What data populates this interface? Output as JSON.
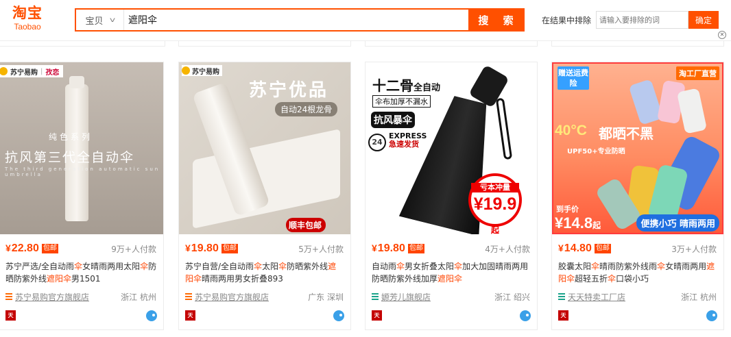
{
  "header": {
    "logo_cn": "淘宝",
    "logo_en": "Taobao",
    "search_category": "宝贝",
    "search_value": "遮阳伞",
    "search_button": "搜 索",
    "exclude_label": "在结果中排除",
    "exclude_placeholder": "请输入要排除的词",
    "exclude_button": "确定"
  },
  "products": [
    {
      "price": "22.80",
      "currency": "¥",
      "tag": "包邮",
      "sold": "9万+人付款",
      "title_parts": [
        "苏宁严选/全自动雨",
        "伞",
        "女晴雨两用太阳",
        "伞",
        "防晒防紫外线",
        "遮阳伞",
        "男1501"
      ],
      "shop": "苏宁易购官方旗舰店",
      "location": "浙江 杭州",
      "shop_icon_color": "orange",
      "image": {
        "brand": "苏宁易购",
        "brand_sub": "孜恋",
        "series": "纯色系列",
        "headline": "抗风第三代全自动伞",
        "small": "The third generation automatic sun umbrella"
      }
    },
    {
      "price": "19.80",
      "currency": "¥",
      "tag": "包邮",
      "sold": "5万+人付款",
      "title_parts": [
        "苏宁自营/全自动雨",
        "伞",
        "太阳",
        "伞",
        "防晒紫外线",
        "遮阳伞",
        "晴雨两用男女折叠893"
      ],
      "shop": "苏宁易购官方旗舰店",
      "location": "广东 深圳",
      "shop_icon_color": "orange",
      "image": {
        "brand": "苏宁易购",
        "headline": "苏宁优品",
        "pill": "自动24根龙骨",
        "ship": "顺丰包邮"
      }
    },
    {
      "price": "19.80",
      "currency": "¥",
      "tag": "包邮",
      "sold": "4万+人付款",
      "title_parts": [
        "自动雨",
        "伞",
        "男女折叠太阳",
        "伞",
        "加大加固晴雨两用防晒防紫外线加厚",
        "遮阳伞",
        ""
      ],
      "shop": "嫄芳儿旗舰店",
      "location": "浙江 绍兴",
      "shop_icon_color": "green",
      "image": {
        "headline": "十二骨",
        "headline_small": "全自动",
        "sub": "伞布加厚不漏水",
        "wind": "抗风暴伞",
        "circle": "24",
        "express": "EXPRESS",
        "express_sub": "急速发货",
        "ball_title": "亏本冲量",
        "ball_price": "¥19.9",
        "ball_suffix": "起"
      }
    },
    {
      "price": "14.80",
      "currency": "¥",
      "tag": "包邮",
      "sold": "3万+人付款",
      "title_parts": [
        "胶囊太阳",
        "伞",
        "晴雨防紫外线雨",
        "伞",
        "女晴雨两用",
        "遮阳伞",
        "超轻五折",
        "伞",
        "口袋小巧"
      ],
      "shop": "天天特卖工厂店",
      "location": "浙江 杭州",
      "shop_icon_color": "green",
      "image": {
        "gift": "赠送运费险",
        "factory": "淘工厂直营",
        "temp": "40°C",
        "rain": "都晒不黑",
        "upf": "UPF50+专业防晒",
        "hand_label": "到手价",
        "hand_price": "¥14.8",
        "hand_suffix": "起",
        "slogan": "便携小巧 晴雨两用"
      }
    }
  ],
  "colors": {
    "accent": "#ff5000",
    "price": "#ff4400"
  }
}
